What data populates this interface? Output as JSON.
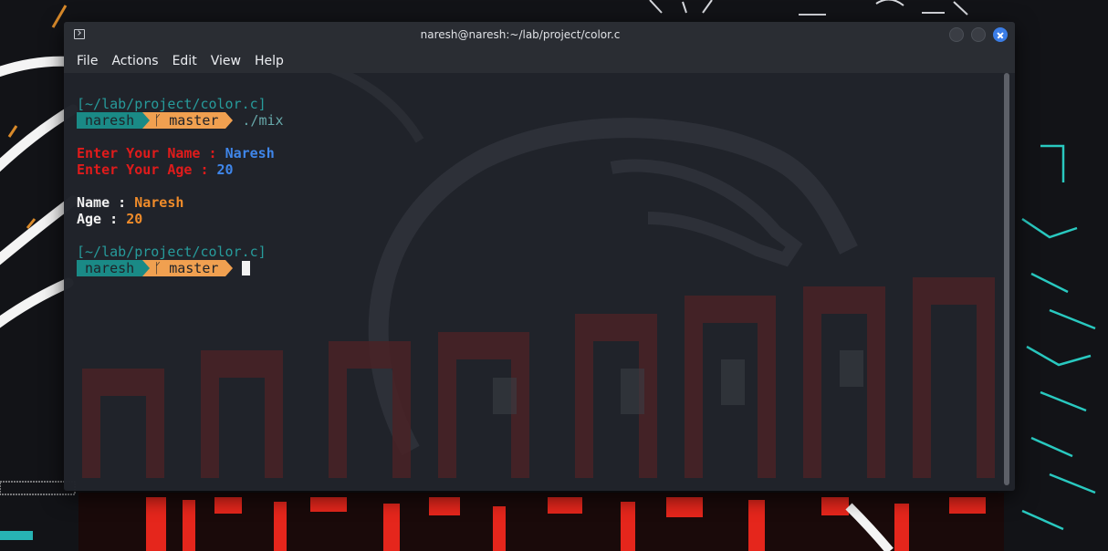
{
  "window": {
    "title": "naresh@naresh:~/lab/project/color.c"
  },
  "menu": {
    "file": "File",
    "actions": "Actions",
    "edit": "Edit",
    "view": "View",
    "help": "Help"
  },
  "terminal": {
    "path_1": "[~/lab/project/color.c]",
    "user_1": "naresh",
    "branch_icon": "ᚴ",
    "branch_1": "master",
    "command_1": "./mix",
    "name_prompt": "Enter Your Name : ",
    "name_input": "Naresh",
    "age_prompt": "Enter Your Age : ",
    "age_input": "20",
    "name_label": "Name : ",
    "name_value": "Naresh",
    "age_label": "Age : ",
    "age_value": "20",
    "path_2": "[~/lab/project/color.c]",
    "user_2": "naresh",
    "branch_2": "master"
  },
  "icons": {
    "window_icon": "terminal-icon",
    "branch": "git-branch-icon"
  },
  "colors": {
    "accent_teal": "#1a8a86",
    "accent_orange": "#f0a050",
    "prompt_red": "#e01b1b",
    "input_blue": "#3f86ea",
    "value_orange": "#f08c2a",
    "close_button": "#3b7de6"
  }
}
